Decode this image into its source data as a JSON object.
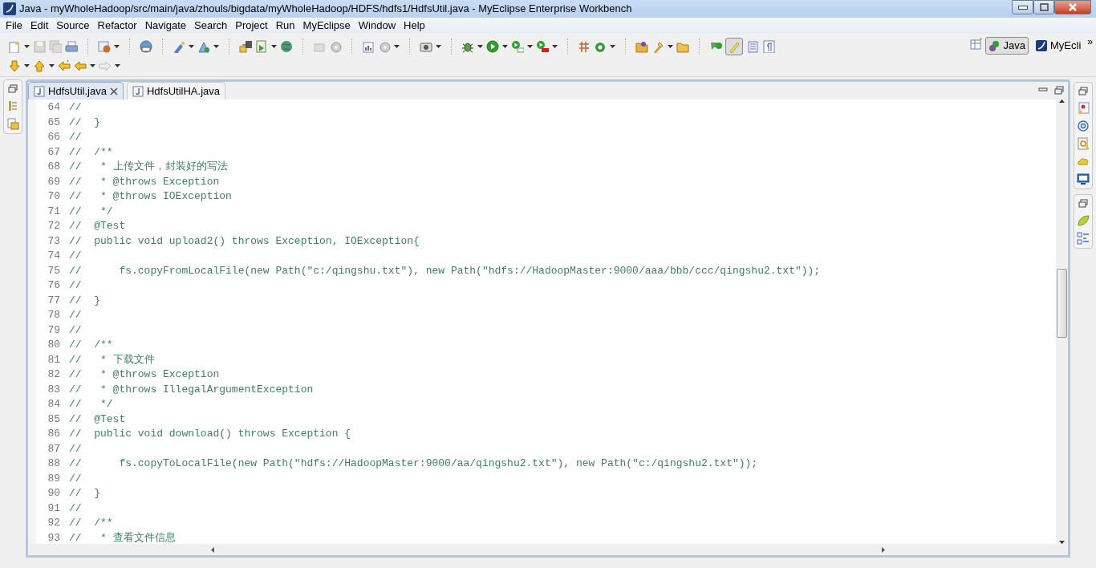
{
  "window": {
    "title": "Java - myWholeHadoop/src/main/java/zhouls/bigdata/myWholeHadoop/HDFS/hdfs1/HdfsUtil.java - MyEclipse Enterprise Workbench"
  },
  "menu": [
    "File",
    "Edit",
    "Source",
    "Refactor",
    "Navigate",
    "Search",
    "Project",
    "Run",
    "MyEclipse",
    "Window",
    "Help"
  ],
  "perspectives": [
    {
      "label": "Java",
      "selected": true
    },
    {
      "label": "MyEcli",
      "selected": false
    }
  ],
  "perspective_overflow": "»",
  "tabs": [
    {
      "label": "HdfsUtil.java",
      "selected": true
    },
    {
      "label": "HdfsUtilHA.java",
      "selected": false
    }
  ],
  "lines": [
    {
      "number": "64",
      "text": "//"
    },
    {
      "number": "65",
      "text": "//  }"
    },
    {
      "number": "66",
      "text": "//"
    },
    {
      "number": "67",
      "text": "//  /**"
    },
    {
      "number": "68",
      "text": "//   * 上传文件，封装好的写法"
    },
    {
      "number": "69",
      "text": "//   * @throws Exception"
    },
    {
      "number": "70",
      "text": "//   * @throws IOException"
    },
    {
      "number": "71",
      "text": "//   */"
    },
    {
      "number": "72",
      "text": "//  @Test"
    },
    {
      "number": "73",
      "text": "//  public void upload2() throws Exception, IOException{"
    },
    {
      "number": "74",
      "text": "//"
    },
    {
      "number": "75",
      "text": "//      fs.copyFromLocalFile(new Path(\"c:/qingshu.txt\"), new Path(\"hdfs://HadoopMaster:9000/aaa/bbb/ccc/qingshu2.txt\"));"
    },
    {
      "number": "76",
      "text": "//"
    },
    {
      "number": "77",
      "text": "//  }"
    },
    {
      "number": "78",
      "text": "//"
    },
    {
      "number": "79",
      "text": "//"
    },
    {
      "number": "80",
      "text": "//  /**"
    },
    {
      "number": "81",
      "text": "//   * 下载文件"
    },
    {
      "number": "82",
      "text": "//   * @throws Exception"
    },
    {
      "number": "83",
      "text": "//   * @throws IllegalArgumentException"
    },
    {
      "number": "84",
      "text": "//   */"
    },
    {
      "number": "85",
      "text": "//  @Test"
    },
    {
      "number": "86",
      "text": "//  public void download() throws Exception {"
    },
    {
      "number": "87",
      "text": "//"
    },
    {
      "number": "88",
      "text": "//      fs.copyToLocalFile(new Path(\"hdfs://HadoopMaster:9000/aa/qingshu2.txt\"), new Path(\"c:/qingshu2.txt\"));"
    },
    {
      "number": "89",
      "text": "//"
    },
    {
      "number": "90",
      "text": "//  }"
    },
    {
      "number": "91",
      "text": "//"
    },
    {
      "number": "92",
      "text": "//  /**"
    },
    {
      "number": "93",
      "text": "//   * 查看文件信息"
    }
  ]
}
